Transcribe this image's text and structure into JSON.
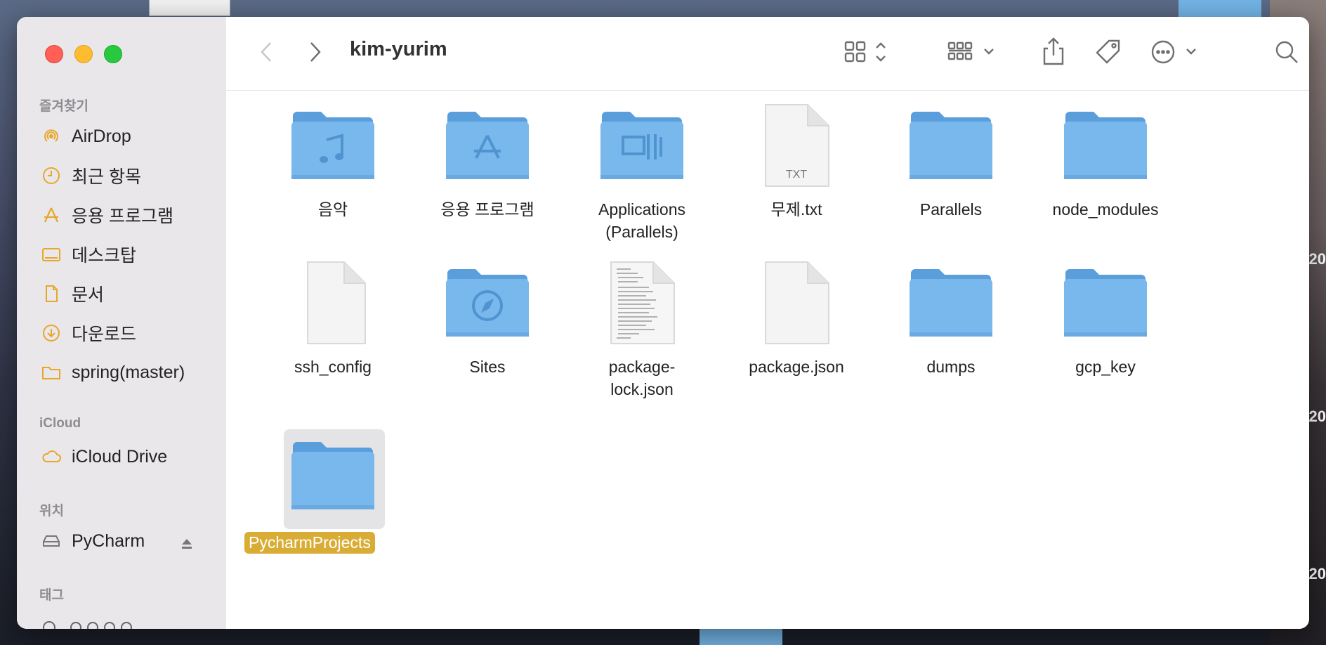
{
  "window": {
    "title": "kim-yurim"
  },
  "sidebar": {
    "sections": {
      "favorites": "즐겨찾기",
      "icloud": "iCloud",
      "locations": "위치",
      "tags": "태그"
    },
    "favorites": [
      {
        "label": "AirDrop",
        "icon": "airdrop-icon"
      },
      {
        "label": "최근 항목",
        "icon": "clock-icon"
      },
      {
        "label": "응용 프로그램",
        "icon": "applications-icon"
      },
      {
        "label": "데스크탑",
        "icon": "desktop-icon"
      },
      {
        "label": "문서",
        "icon": "document-icon"
      },
      {
        "label": "다운로드",
        "icon": "download-icon"
      },
      {
        "label": "spring(master)",
        "icon": "folder-icon"
      }
    ],
    "icloud": [
      {
        "label": "iCloud Drive",
        "icon": "cloud-icon"
      }
    ],
    "locations": [
      {
        "label": "PyCharm",
        "icon": "drive-icon"
      }
    ],
    "tags_partial": "",
    "accent_color": "#e7a72a"
  },
  "toolbar": {
    "view_mode": "icons",
    "icons": [
      "back-icon",
      "forward-icon",
      "icon-view-icon",
      "group-icon",
      "share-icon",
      "tag-icon",
      "more-icon",
      "search-icon"
    ]
  },
  "files": [
    {
      "name": "음악",
      "kind": "folder",
      "badge": "music"
    },
    {
      "name": "응용 프로그램",
      "kind": "folder",
      "badge": "apps"
    },
    {
      "name": "Applications\n(Parallels)",
      "kind": "folder",
      "badge": "parallels"
    },
    {
      "name": "무제.txt",
      "kind": "txt",
      "ext": "TXT"
    },
    {
      "name": "Parallels",
      "kind": "folder"
    },
    {
      "name": "node_modules",
      "kind": "folder"
    },
    {
      "name": "ssh_config",
      "kind": "file"
    },
    {
      "name": "Sites",
      "kind": "folder",
      "badge": "safari"
    },
    {
      "name": "package-\nlock.json",
      "kind": "doc"
    },
    {
      "name": "package.json",
      "kind": "file"
    },
    {
      "name": "dumps",
      "kind": "folder"
    },
    {
      "name": "gcp_key",
      "kind": "folder"
    },
    {
      "name": "PycharmProjects",
      "kind": "folder",
      "selected": true
    }
  ],
  "colors": {
    "folder": "#79b8ec",
    "folder_dark": "#5a9fdc",
    "selection": "#d9ad35"
  },
  "desktop": {
    "year_label": "20"
  }
}
